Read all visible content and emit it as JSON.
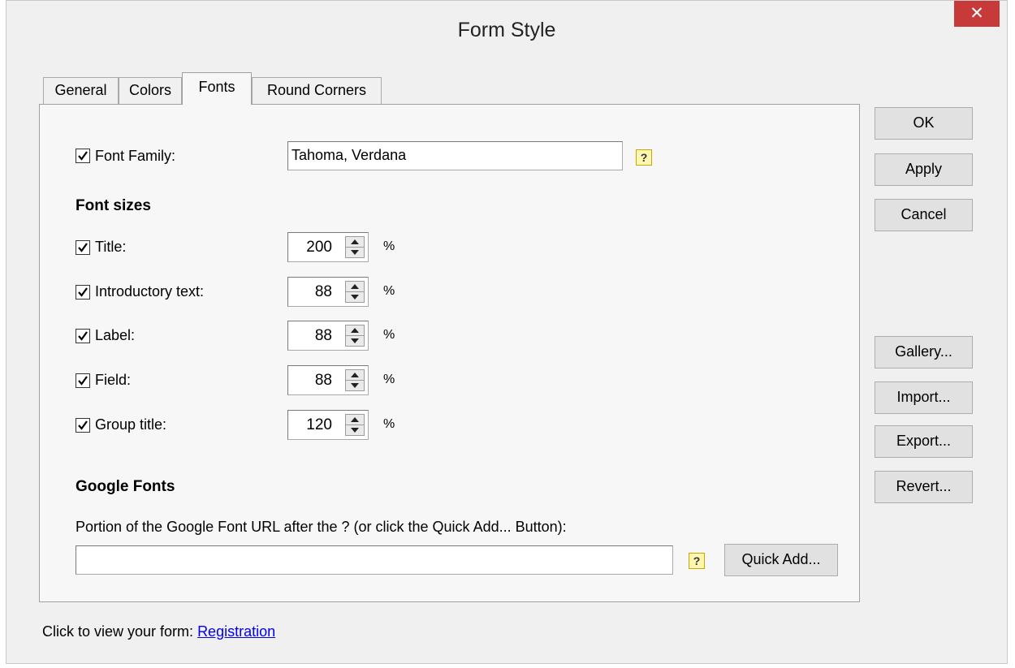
{
  "window": {
    "title": "Form Style",
    "close_label": "✕"
  },
  "tabs": [
    {
      "label": "General",
      "active": false
    },
    {
      "label": "Colors",
      "active": false
    },
    {
      "label": "Fonts",
      "active": true
    },
    {
      "label": "Round Corners",
      "active": false
    }
  ],
  "fonts_tab": {
    "font_family": {
      "label": "Font Family:",
      "checked": true,
      "value": "Tahoma, Verdana",
      "help": "?"
    },
    "font_sizes_heading": "Font sizes",
    "sizes": [
      {
        "label": "Title:",
        "checked": true,
        "value": "200",
        "unit": "%"
      },
      {
        "label": "Introductory text:",
        "checked": true,
        "value": "88",
        "unit": "%"
      },
      {
        "label": "Label:",
        "checked": true,
        "value": "88",
        "unit": "%"
      },
      {
        "label": "Field:",
        "checked": true,
        "value": "88",
        "unit": "%"
      },
      {
        "label": "Group title:",
        "checked": true,
        "value": "120",
        "unit": "%"
      }
    ],
    "google_fonts_heading": "Google Fonts",
    "google_fonts_prompt": "Portion of the Google Font URL after the ? (or click the Quick Add... Button):",
    "google_fonts_value": "",
    "google_help": "?",
    "quick_add_label": "Quick Add..."
  },
  "buttons": {
    "ok": "OK",
    "apply": "Apply",
    "cancel": "Cancel",
    "gallery": "Gallery...",
    "import": "Import...",
    "export": "Export...",
    "revert": "Revert..."
  },
  "footer": {
    "prompt": "Click to view your form:",
    "link": "Registration"
  },
  "colors": {
    "close_red": "#c73a3a",
    "link_blue": "#0000ee",
    "help_yellow": "#fff7b0"
  }
}
